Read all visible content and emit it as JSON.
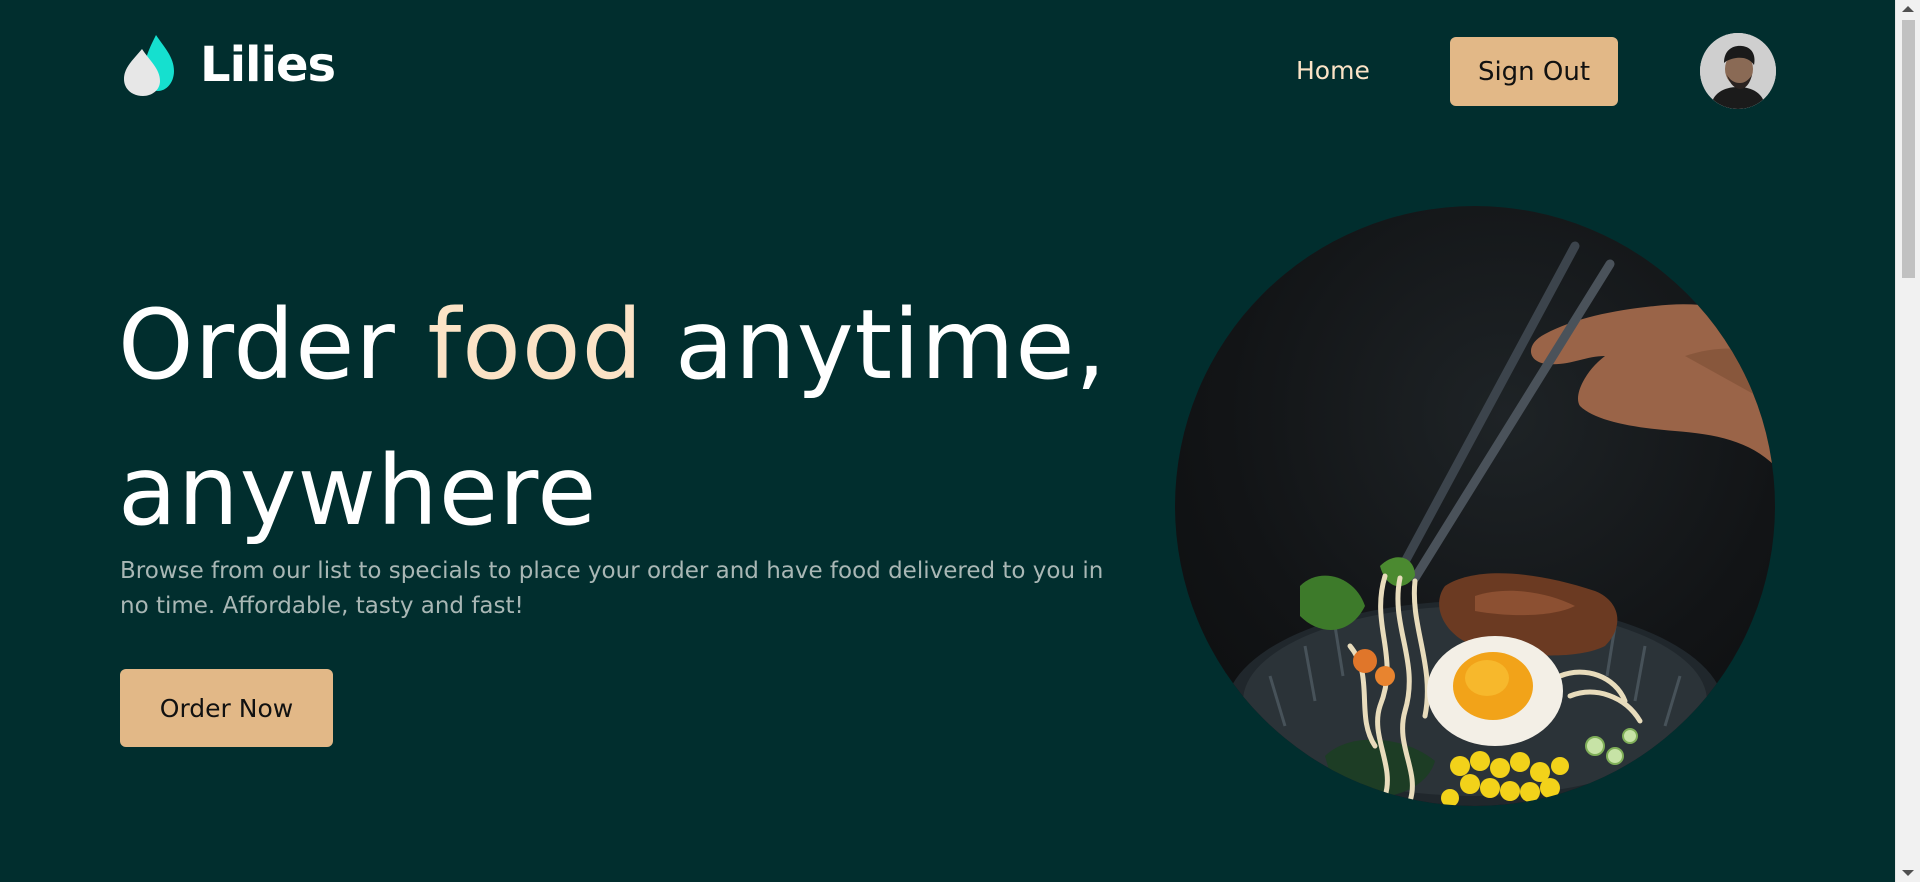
{
  "header": {
    "brand": "Lilies",
    "nav_home": "Home",
    "sign_out_label": "Sign Out"
  },
  "hero": {
    "title_part1": "Order ",
    "title_accent": "food",
    "title_part2": " anytime,",
    "title_line2": "anywhere",
    "description": "Browse from our list to specials to place your order and have food delivered to you in no time. Affordable, tasty and fast!",
    "cta_label": "Order Now"
  },
  "colors": {
    "background": "#012e2e",
    "accent_text": "#fbe3c6",
    "button": "#e2b887",
    "logo_teal": "#15e0cf",
    "muted_text": "#a9b7b5"
  },
  "icons": {
    "logo": "droplet-logo-icon",
    "avatar": "user-avatar"
  }
}
